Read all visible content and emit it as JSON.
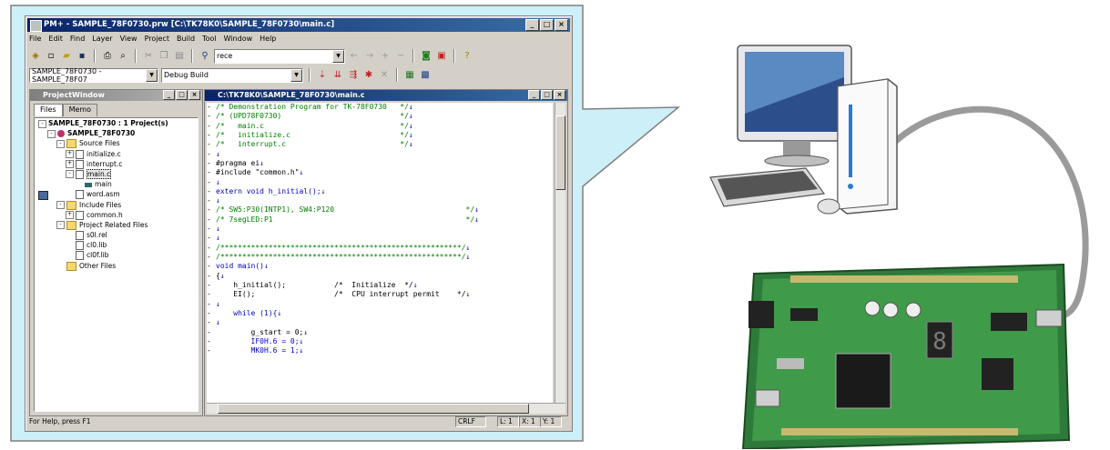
{
  "app": {
    "title": "PM+ - SAMPLE_78F0730.prw [C:\\TK78K0\\SAMPLE_78F0730\\main.c]",
    "menu": [
      "File",
      "Edit",
      "Find",
      "Layer",
      "View",
      "Project",
      "Build",
      "Tool",
      "Window",
      "Help"
    ],
    "search_value": "rece",
    "project_combo": "SAMPLE_78F0730 - SAMPLE_78F07",
    "build_combo": "Debug Build",
    "status_help": "For Help, press F1",
    "status_crlf": "CRLF",
    "status_line": "L: 1",
    "status_x": "X: 1",
    "status_y": "Y: 1"
  },
  "project_window": {
    "title": "ProjectWindow",
    "tabs": [
      "Files",
      "Memo"
    ],
    "tree": [
      {
        "label": "SAMPLE_78F0730 : 1 Project(s)",
        "level": 0,
        "icon": "workspace-icon",
        "expander": "-",
        "bold": true
      },
      {
        "label": "SAMPLE_78F0730",
        "level": 1,
        "icon": "project-icon",
        "expander": "-",
        "bold": true
      },
      {
        "label": "Source Files",
        "level": 2,
        "icon": "folder-icon",
        "expander": "-"
      },
      {
        "label": "initialize.c",
        "level": 3,
        "icon": "file-icon",
        "expander": "+"
      },
      {
        "label": "interrupt.c",
        "level": 3,
        "icon": "file-icon",
        "expander": "+"
      },
      {
        "label": "main.c",
        "level": 3,
        "icon": "file-icon",
        "expander": "-",
        "selected": true
      },
      {
        "label": "main",
        "level": 4,
        "icon": "function-icon",
        "expander": ""
      },
      {
        "label": "word.asm",
        "level": 3,
        "icon": "file-icon",
        "expander": ""
      },
      {
        "label": "Include Files",
        "level": 2,
        "icon": "folder-icon",
        "expander": "-"
      },
      {
        "label": "common.h",
        "level": 3,
        "icon": "file-icon",
        "expander": "+"
      },
      {
        "label": "Project Related Files",
        "level": 2,
        "icon": "folder-icon",
        "expander": "-"
      },
      {
        "label": "s0l.rel",
        "level": 3,
        "icon": "file-icon",
        "expander": ""
      },
      {
        "label": "cl0.lib",
        "level": 3,
        "icon": "file-icon",
        "expander": ""
      },
      {
        "label": "cl0f.lib",
        "level": 3,
        "icon": "file-icon",
        "expander": ""
      },
      {
        "label": "Other Files",
        "level": 2,
        "icon": "folder-icon",
        "expander": ""
      }
    ]
  },
  "editor": {
    "title": "C:\\TK78K0\\SAMPLE_78F0730\\main.c",
    "lines": [
      {
        "text": "/* Demonstration Program for TK-78F0730   */",
        "cls": "cm"
      },
      {
        "text": "/* (UPD78F0730)                           */",
        "cls": "cm"
      },
      {
        "text": "/*   main.c                               */",
        "cls": "cm"
      },
      {
        "text": "/*   initialize.c                         */",
        "cls": "cm"
      },
      {
        "text": "/*   interrupt.c                          */",
        "cls": "cm"
      },
      {
        "text": "",
        "cls": ""
      },
      {
        "text": "#pragma ei",
        "cls": ""
      },
      {
        "text": "#include \"common.h\"",
        "cls": ""
      },
      {
        "text": "",
        "cls": ""
      },
      {
        "text": "extern void h_initial();",
        "cls": "kw"
      },
      {
        "text": "",
        "cls": ""
      },
      {
        "text": "/* SW5:P30(INTP1), SW4:P120                              */",
        "cls": "cm"
      },
      {
        "text": "/* 7segLED:P1                                            */",
        "cls": "cm"
      },
      {
        "text": "",
        "cls": ""
      },
      {
        "text": "",
        "cls": ""
      },
      {
        "text": "/*******************************************************/",
        "cls": "cm"
      },
      {
        "text": "/*******************************************************/",
        "cls": "cm"
      },
      {
        "text": "void main()",
        "cls": "kw"
      },
      {
        "text": "{",
        "cls": ""
      },
      {
        "text": "    h_initial();           /*  Initialize  */",
        "cls": "mix1"
      },
      {
        "text": "    EI();                  /*  CPU interrupt permit    */",
        "cls": "mix2"
      },
      {
        "text": "",
        "cls": ""
      },
      {
        "text": "    while (1){",
        "cls": "kw"
      },
      {
        "text": "",
        "cls": ""
      },
      {
        "text": "        g_start = 0;",
        "cls": ""
      },
      {
        "text": "        IF0H.6 = 0;",
        "cls": "kw"
      },
      {
        "text": "        MK0H.6 = 1;",
        "cls": "kw"
      }
    ]
  }
}
